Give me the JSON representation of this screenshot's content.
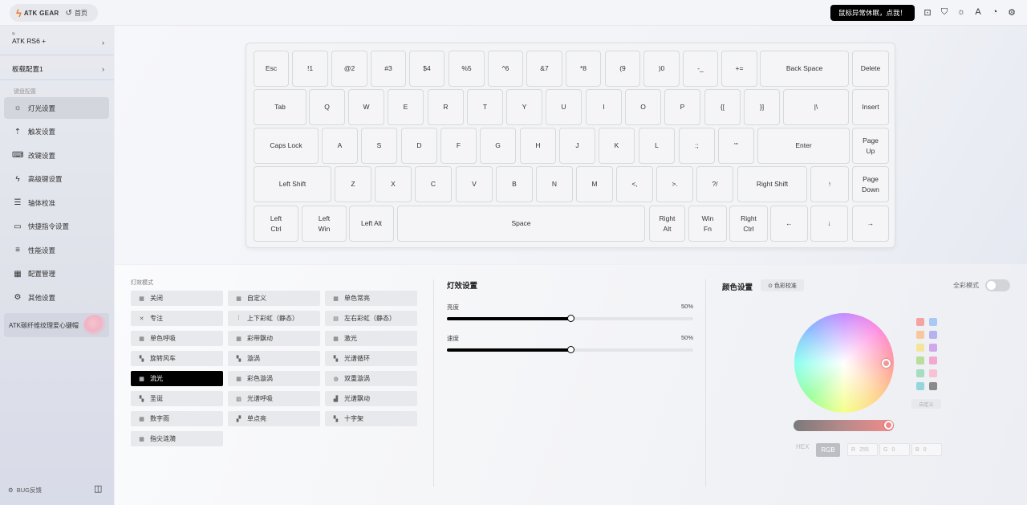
{
  "topbar": {
    "brand": "ATK GEAR",
    "home": "首页",
    "alert": "鼠标异常休眠，点我！",
    "icons": [
      "feedback-icon",
      "theme-shirt-icon",
      "brightness-icon",
      "language-icon",
      "user-icon",
      "settings-gear-icon"
    ]
  },
  "sidebar": {
    "device_signal": "≈",
    "device_name": "ATK RS6 +",
    "board_config": "板载配置1",
    "section_title": "键盘配置",
    "items": [
      {
        "label": "灯光设置",
        "icon": "☼"
      },
      {
        "label": "触发设置",
        "icon": "⇡"
      },
      {
        "label": "改键设置",
        "icon": "⌨"
      },
      {
        "label": "高级键设置",
        "icon": "ϟ"
      },
      {
        "label": "轴体校准",
        "icon": "☰"
      },
      {
        "label": "快捷指令设置",
        "icon": "▭"
      },
      {
        "label": "性能设置",
        "icon": "≡"
      },
      {
        "label": "配置管理",
        "icon": "▦"
      },
      {
        "label": "其他设置",
        "icon": "⚙"
      }
    ],
    "promo": "ATK碳纤维纹理爱心键帽",
    "bug": "BUG反馈"
  },
  "keyboard": {
    "rows": [
      [
        "Esc",
        "!1",
        "@2",
        "#3",
        "$4",
        "%5",
        "^6",
        "&7",
        "*8",
        "(9",
        ")0",
        "-_",
        "+=",
        "Back Space",
        "Delete"
      ],
      [
        "Tab",
        "Q",
        "W",
        "E",
        "R",
        "T",
        "Y",
        "U",
        "I",
        "O",
        "P",
        "{[",
        "}]",
        "|\\",
        "Insert"
      ],
      [
        "Caps Lock",
        "A",
        "S",
        "D",
        "F",
        "G",
        "H",
        "J",
        "K",
        "L",
        ":;",
        "\"'",
        "Enter",
        "Page\nUp"
      ],
      [
        "Left Shift",
        "Z",
        "X",
        "C",
        "V",
        "B",
        "N",
        "M",
        "<,",
        ">.",
        "?/",
        "Right Shift",
        "↑",
        "Page\nDown"
      ],
      [
        "Left\nCtrl",
        "Left\nWin",
        "Left Alt",
        "Space",
        "Right\nAlt",
        "Win\nFn",
        "Right\nCtrl",
        "←",
        "↓",
        "→"
      ]
    ]
  },
  "effects": {
    "title": "灯效模式",
    "selected": "流光",
    "items": [
      {
        "label": "关闭",
        "icon": "▦"
      },
      {
        "label": "自定义",
        "icon": "▦"
      },
      {
        "label": "单色常亮",
        "icon": "▦"
      },
      {
        "label": "专注",
        "icon": "✕"
      },
      {
        "label": "上下彩虹（静态）",
        "icon": "⁞"
      },
      {
        "label": "左右彩虹（静态）",
        "icon": "▤"
      },
      {
        "label": "单色呼吸",
        "icon": "▦"
      },
      {
        "label": "彩带飘动",
        "icon": "▦"
      },
      {
        "label": "激光",
        "icon": "▦"
      },
      {
        "label": "旋转风车",
        "icon": "▚"
      },
      {
        "label": "漩涡",
        "icon": "▚"
      },
      {
        "label": "光谱循环",
        "icon": "▚"
      },
      {
        "label": "流光",
        "icon": "▦"
      },
      {
        "label": "彩色漩涡",
        "icon": "▦"
      },
      {
        "label": "双重漩涡",
        "icon": "◍"
      },
      {
        "label": "圣诞",
        "icon": "▚"
      },
      {
        "label": "光谱呼吸",
        "icon": "▨"
      },
      {
        "label": "光谱飘动",
        "icon": "▟"
      },
      {
        "label": "数字雨",
        "icon": "▦"
      },
      {
        "label": "单点亮",
        "icon": "▞"
      },
      {
        "label": "十字架",
        "icon": "▚"
      },
      {
        "label": "指尖涟漪",
        "icon": "▦"
      }
    ]
  },
  "light_settings": {
    "title": "灯效设置",
    "brightness_label": "亮度",
    "brightness_value": "50%",
    "brightness": 0.5,
    "speed_label": "速度",
    "speed_value": "50%",
    "speed": 0.5
  },
  "color_settings": {
    "title": "颜色设置",
    "calibrate": "色彩校准",
    "full_color_label": "全彩模式",
    "full_color_on": false,
    "swatches": [
      "#f4a3a3",
      "#a9c8f5",
      "#f8c79b",
      "#b6b1f0",
      "#f5e59a",
      "#cfa8ee",
      "#b9dd9a",
      "#f3a8d2",
      "#a7dcc0",
      "#f7c2d4",
      "#95d6dc",
      "#8a8a8a"
    ],
    "custom_label": "自定义",
    "formats": [
      "HEX",
      "RGB"
    ],
    "active_format": "RGB",
    "r_label": "R",
    "r_value": "255",
    "g_label": "G",
    "g_value": "0",
    "b_label": "B",
    "b_value": "0"
  }
}
